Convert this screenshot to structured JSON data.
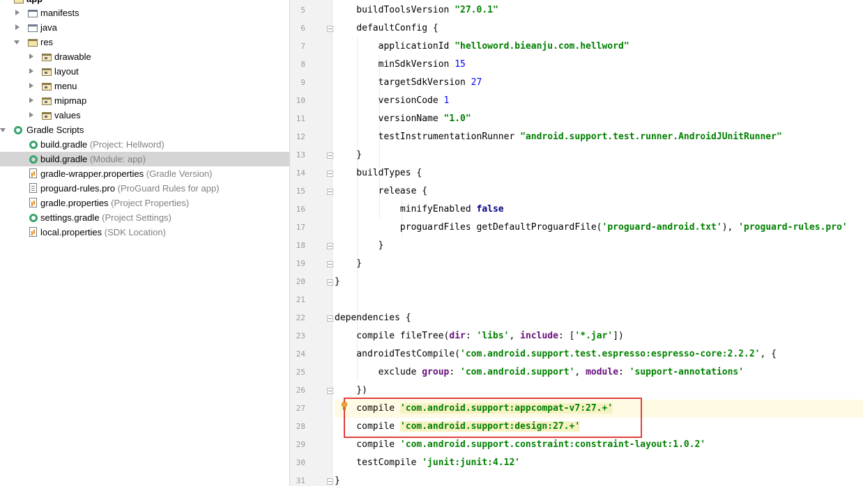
{
  "tree": {
    "top_label": "app",
    "items": [
      {
        "label": "manifests",
        "hint": ""
      },
      {
        "label": "java",
        "hint": ""
      },
      {
        "label": "res",
        "hint": ""
      },
      {
        "label": "drawable",
        "hint": ""
      },
      {
        "label": "layout",
        "hint": ""
      },
      {
        "label": "menu",
        "hint": ""
      },
      {
        "label": "mipmap",
        "hint": ""
      },
      {
        "label": "values",
        "hint": ""
      },
      {
        "label": "Gradle Scripts",
        "hint": ""
      },
      {
        "label": "build.gradle",
        "hint": "(Project: Hellword)"
      },
      {
        "label": "build.gradle",
        "hint": "(Module: app)"
      },
      {
        "label": "gradle-wrapper.properties",
        "hint": "(Gradle Version)"
      },
      {
        "label": "proguard-rules.pro",
        "hint": "(ProGuard Rules for app)"
      },
      {
        "label": "gradle.properties",
        "hint": "(Project Properties)"
      },
      {
        "label": "settings.gradle",
        "hint": "(Project Settings)"
      },
      {
        "label": "local.properties",
        "hint": "(SDK Location)"
      }
    ],
    "icons": [
      "folder-icon",
      "folder-icon",
      "res-folder-icon",
      "resource-folder-icon",
      "resource-folder-icon",
      "resource-folder-icon",
      "resource-folder-icon",
      "resource-folder-icon",
      "gradle-scripts-icon",
      "gradle-file-icon",
      "gradle-file-icon",
      "properties-file-icon",
      "text-file-icon",
      "properties-file-icon",
      "gradle-file-icon",
      "properties-file-icon"
    ]
  },
  "editor": {
    "line_numbers": [
      "5",
      "6",
      "7",
      "8",
      "9",
      "10",
      "11",
      "12",
      "13",
      "14",
      "15",
      "16",
      "17",
      "18",
      "19",
      "20",
      "21",
      "22",
      "23",
      "24",
      "25",
      "26",
      "27",
      "28",
      "29",
      "30",
      "31"
    ],
    "lines": [
      [
        "    buildToolsVersion ",
        "\"27.0.1\""
      ],
      [
        "    defaultConfig {"
      ],
      [
        "        applicationId ",
        "\"helloword.bieanju.com.hellword\""
      ],
      [
        "        minSdkVersion ",
        "15"
      ],
      [
        "        targetSdkVersion ",
        "27"
      ],
      [
        "        versionCode ",
        "1"
      ],
      [
        "        versionName ",
        "\"1.0\""
      ],
      [
        "        testInstrumentationRunner ",
        "\"android.support.test.runner.AndroidJUnitRunner\""
      ],
      [
        "    }"
      ],
      [
        "    buildTypes {"
      ],
      [
        "        release {"
      ],
      [
        "            minifyEnabled ",
        "false"
      ],
      [
        "            proguardFiles getDefaultProguardFile(",
        "'proguard-android.txt'",
        "), ",
        "'proguard-rules.pro'"
      ],
      [
        "        }"
      ],
      [
        "    }"
      ],
      [
        "}"
      ],
      [
        ""
      ],
      [
        "dependencies {"
      ],
      [
        "    compile fileTree(",
        "dir",
        ": ",
        "'libs'",
        ", ",
        "include",
        ": [",
        "'*.jar'",
        "])"
      ],
      [
        "    androidTestCompile(",
        "'com.android.support.test.espresso:espresso-core:2.2.2'",
        ", {"
      ],
      [
        "        exclude ",
        "group",
        ": ",
        "'com.android.support'",
        ", ",
        "module",
        ": ",
        "'support-annotations'"
      ],
      [
        "    })"
      ],
      [
        "    compile ",
        "'com.android.support:appcompat-v7:27.+'"
      ],
      [
        "    compile ",
        "'com.android.support:design:27.+'"
      ],
      [
        "    compile ",
        "'com.android.support.constraint:constraint-layout:1.0.2'"
      ],
      [
        "    testCompile ",
        "'junit:junit:4.12'"
      ],
      [
        "}"
      ]
    ]
  }
}
